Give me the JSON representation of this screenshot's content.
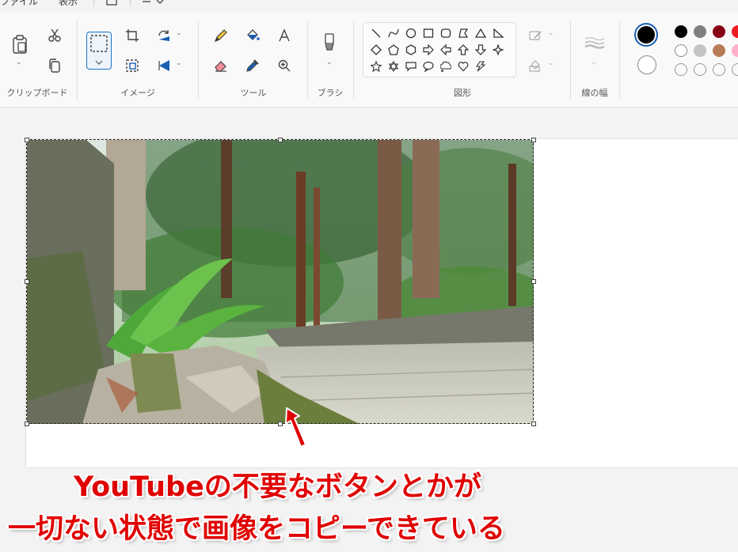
{
  "menubar": {
    "file": "ファイル",
    "view": "表示"
  },
  "ribbon": {
    "groups": {
      "clipboard": "クリップボード",
      "image": "イメージ",
      "tools": "ツール",
      "brush": "ブラシ",
      "shapes": "図形",
      "stroke": "線の幅"
    }
  },
  "colors": {
    "primary": "#000000",
    "secondary": "#ffffff",
    "palette_row1": [
      "#000000",
      "#7f7f7f",
      "#880015",
      "#ed1c24"
    ],
    "palette_row2": [
      "#ffffff",
      "#c3c3c3",
      "#b97a57",
      "#ffaec9"
    ],
    "palette_row3": [
      "",
      "",
      "",
      ""
    ]
  },
  "annotation": {
    "line1": "YouTubeの不要なボタンとかが",
    "line2": "一切ない状態で画像をコピーできている",
    "color": "#e00000"
  }
}
